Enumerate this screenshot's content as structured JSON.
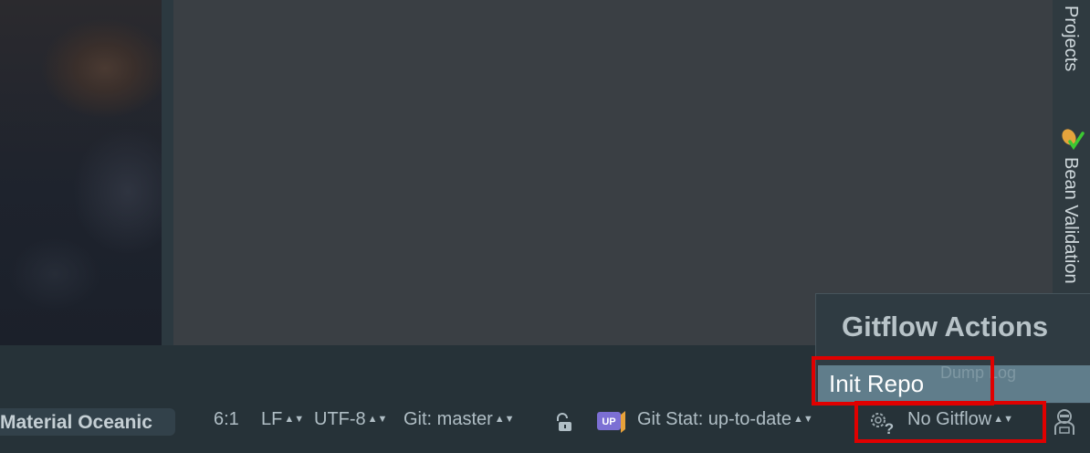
{
  "sidebar": {
    "tabs": [
      {
        "label": "Projects"
      },
      {
        "label": "Bean Validation"
      }
    ]
  },
  "popup": {
    "title": "Gitflow Actions",
    "items": [
      {
        "label": "Init Repo"
      }
    ],
    "hidden_text": "Dump Log"
  },
  "status_bar": {
    "theme": "Material Oceanic",
    "position": "6:1",
    "line_separator": "LF",
    "encoding": "UTF-8",
    "git_branch": "Git: master",
    "git_stat": "Git Stat: up-to-date",
    "gitflow": "No Gitflow",
    "updown_badge": "UP"
  },
  "icons": {
    "lock": "lock-icon",
    "git_stat": "git-stat-up-icon",
    "gitflow": "gear-question-icon",
    "inspector": "hector-inspector-icon",
    "bean": "bean-validation-icon"
  },
  "colors": {
    "highlight": "#e00000",
    "selected_row": "#607d8b",
    "background": "#263238",
    "editor": "#3a3f44"
  }
}
